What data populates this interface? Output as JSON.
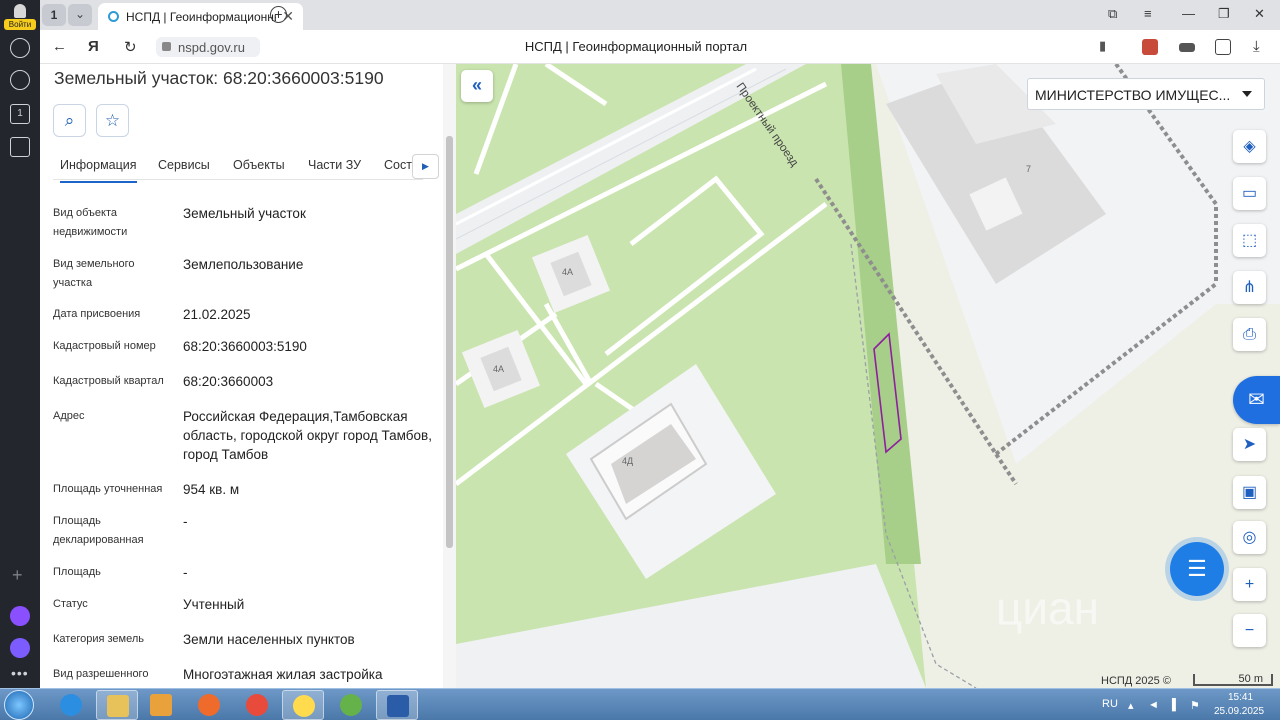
{
  "browser": {
    "login_label": "Войти",
    "tab_count": "1",
    "tab_title": "НСПД | Геоинформационный портал",
    "url": "nspd.gov.ru",
    "page_title": "НСПД | Геоинформационный портал"
  },
  "panel": {
    "title": "Земельный участок: 68:20:3660003:5190",
    "tabs": [
      "Информация",
      "Сервисы",
      "Объекты",
      "Части ЗУ",
      "Соста"
    ],
    "rows": [
      {
        "k": "Вид объекта недвижимости",
        "v": "Земельный участок"
      },
      {
        "k": "Вид земельного участка",
        "v": "Землепользование"
      },
      {
        "k": "Дата присвоения",
        "v": "21.02.2025"
      },
      {
        "k": "Кадастровый номер",
        "v": "68:20:3660003:5190"
      },
      {
        "k": "Кадастровый квартал",
        "v": "68:20:3660003"
      },
      {
        "k": "Адрес",
        "v": "Российская Федерация,Тамбовская область, городской округ город Тамбов, город Тамбов"
      },
      {
        "k": "Площадь уточненная",
        "v": "954 кв. м"
      },
      {
        "k": "Площадь декларированная",
        "v": "-"
      },
      {
        "k": "Площадь",
        "v": "-"
      },
      {
        "k": "Статус",
        "v": "Учтенный"
      },
      {
        "k": "Категория земель",
        "v": "Земли населенных пунктов"
      },
      {
        "k": "Вид разрешенного",
        "v": "Многоэтажная жилая застройка"
      }
    ]
  },
  "map": {
    "layer_select": "МИНИСТЕРСТВО ИМУЩЕС...",
    "street_label": "Проектный проезд",
    "building_labels": [
      "4А",
      "4А",
      "4Д",
      "7"
    ],
    "copyright": "НСПД 2025 ©",
    "scale": "50 m",
    "watermark": "циан",
    "colors": {
      "green": "#a8cf8a",
      "grass": "#c6e3a9",
      "parcel": "#8e1f9e",
      "accent": "#1e5fbf"
    }
  },
  "taskbar": {
    "lang": "RU",
    "time": "15:41",
    "date": "25.09.2025"
  }
}
